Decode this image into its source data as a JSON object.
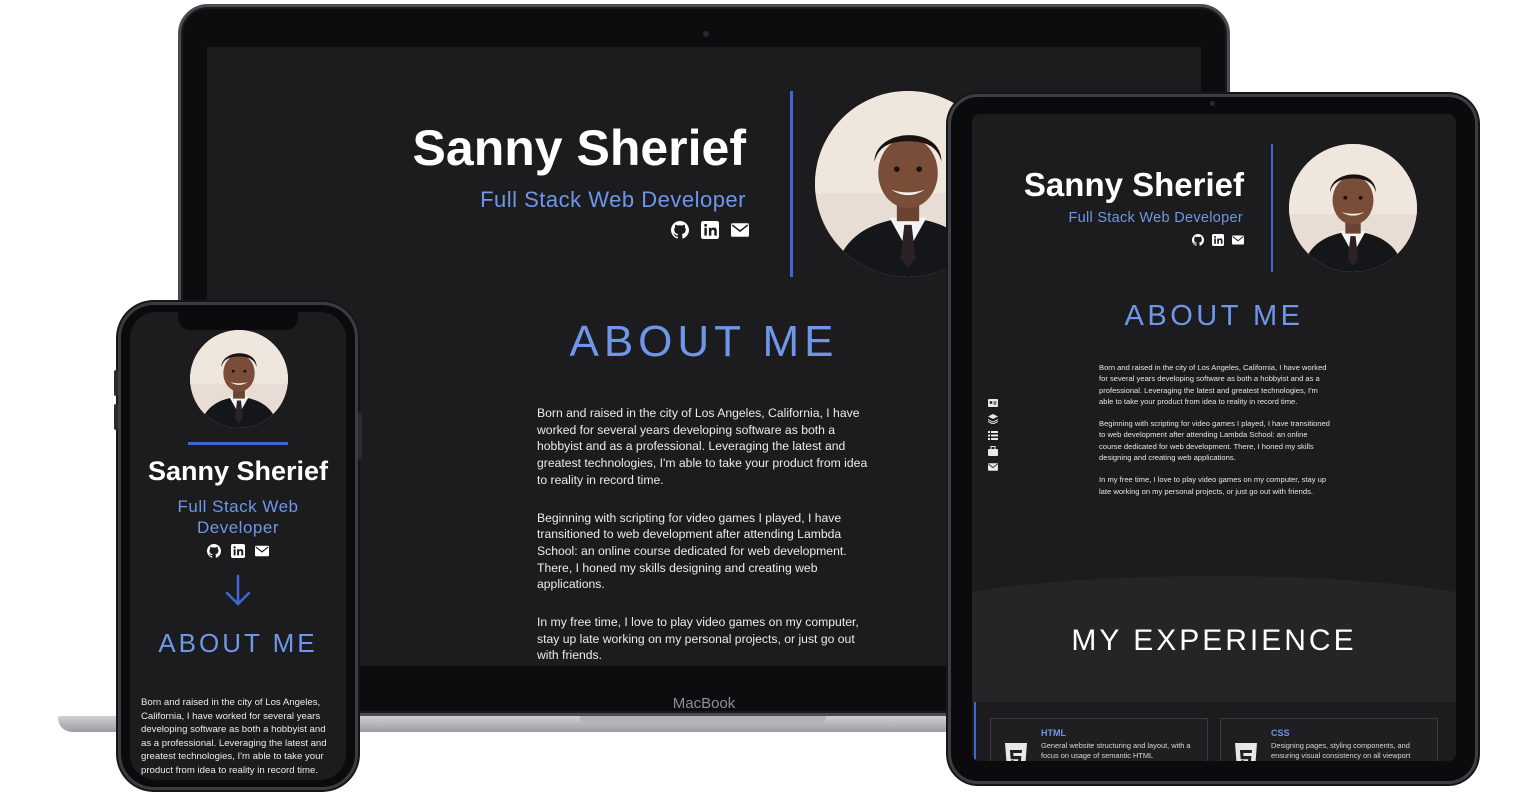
{
  "laptop": {
    "brand": "MacBook",
    "header": {
      "name": "Sanny Sherief",
      "role": "Full Stack Web Developer",
      "social": [
        "github-icon",
        "linkedin-icon",
        "email-icon"
      ]
    },
    "about": {
      "title": "ABOUT ME",
      "paragraphs": [
        "Born and raised in the city of Los Angeles, California, I have worked for several years developing software as both a hobbyist and as a professional. Leveraging the latest and greatest technologies, I'm able to take your product from idea to reality in record time.",
        "Beginning with scripting for video games I played, I have transitioned to web development after attending Lambda School: an online course dedicated for web development. There, I honed my skills designing and creating web applications.",
        "In my free time, I love to play video games on my computer, stay up late working on my personal projects, or just go out with friends."
      ]
    }
  },
  "phone": {
    "header": {
      "name": "Sanny Sherief",
      "role": "Full Stack Web Developer",
      "social": [
        "github-icon",
        "linkedin-icon",
        "email-icon"
      ]
    },
    "about": {
      "title": "ABOUT ME",
      "paragraph": "Born and raised in the city of Los Angeles, California, I have worked for several years developing software as both a hobbyist and as a professional. Leveraging the latest and greatest technologies, I'm able to take your product from idea to reality in record time."
    }
  },
  "tablet": {
    "header": {
      "name": "Sanny Sherief",
      "role": "Full Stack Web Developer",
      "social": [
        "github-icon",
        "linkedin-icon",
        "email-icon"
      ]
    },
    "sidenav": [
      "id-card-icon",
      "layers-icon",
      "list-icon",
      "briefcase-icon",
      "email-icon"
    ],
    "about": {
      "title": "ABOUT ME",
      "paragraphs": [
        "Born and raised in the city of Los Angeles, California, I have worked for several years developing software as both a hobbyist and as a professional. Leveraging the latest and greatest technologies, I'm able to take your product from idea to reality in record time.",
        "Beginning with scripting for video games I played, I have transitioned to web development after attending Lambda School: an online course dedicated for web development. There, I honed my skills designing and creating web applications.",
        "In my free time, I love to play video games on my computer, stay up late working on my personal projects, or just go out with friends."
      ]
    },
    "experience": {
      "title": "MY EXPERIENCE",
      "cards": [
        {
          "title": "HTML",
          "description": "General website structuring and layout, with a focus on usage of semantic HTML",
          "icon": "html5-icon"
        },
        {
          "title": "CSS",
          "description": "Designing pages, styling components, and ensuring visual consistency on all viewport",
          "icon": "css3-icon"
        }
      ]
    }
  },
  "colors": {
    "accent": "#6f96e8",
    "divider": "#3f68d6",
    "background": "#1c1c1e"
  }
}
